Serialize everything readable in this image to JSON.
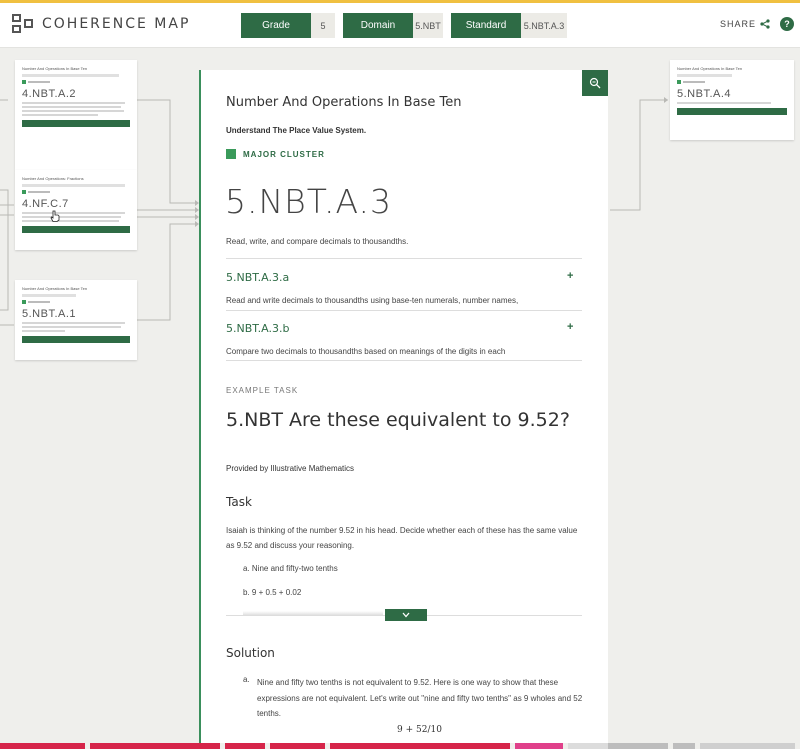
{
  "header": {
    "app_title": "COHERENCE MAP",
    "grade_label": "Grade",
    "grade_value": "5",
    "domain_label": "Domain",
    "domain_value": "5.NBT",
    "standard_label": "Standard",
    "standard_value": "5.NBT.A.3",
    "share_label": "SHARE",
    "help_label": "?"
  },
  "left_cards": [
    {
      "domain": "Number And Operations In Base Ten",
      "code": "4.NBT.A.2"
    },
    {
      "domain": "Number And Operations: Fractions",
      "code": "4.NF.C.7"
    },
    {
      "domain": "Number And Operations In Base Ten",
      "code": "5.NBT.A.1"
    }
  ],
  "right_cards": [
    {
      "domain": "Number And Operations In Base Ten",
      "code": "5.NBT.A.4"
    }
  ],
  "main": {
    "domain": "Number And Operations In Base Ten",
    "cluster": "Understand The Place Value System.",
    "cluster_type": "MAJOR CLUSTER",
    "code": "5.NBT.A.3",
    "description": "Read, write, and compare decimals to thousandths.",
    "substandards": [
      {
        "code": "5.NBT.A.3.a",
        "text": "Read and write decimals to thousandths using base-ten numerals, number names,"
      },
      {
        "code": "5.NBT.A.3.b",
        "text": "Compare two decimals to thousandths based on meanings of the digits in each"
      }
    ],
    "example_label": "EXAMPLE TASK",
    "task_title": "5.NBT Are these equivalent to 9.52?",
    "provided_by": "Provided by Illustrative Mathematics",
    "task_heading": "Task",
    "task_text": "Isaiah is thinking of the number 9.52 in his head. Decide whether each of these has the same value as 9.52 and discuss your reasoning.",
    "task_items": [
      "a. Nine and fifty-two tenths",
      "b. 9 + 0.5 + 0.02"
    ],
    "solution_heading": "Solution",
    "solution_marker": "a.",
    "solution_text": "Nine and fifty two tenths is not equivalent to 9.52. Here is one way to show that these expressions are not equivalent. Let's write out \"nine and fifty two tenths\" as 9 wholes and 52 tenths.",
    "fraction_preview": "9 + 52/10"
  },
  "colors": {
    "brand_green": "#2e6b45",
    "accent_green": "#3a9a5a",
    "background": "#efefec"
  }
}
